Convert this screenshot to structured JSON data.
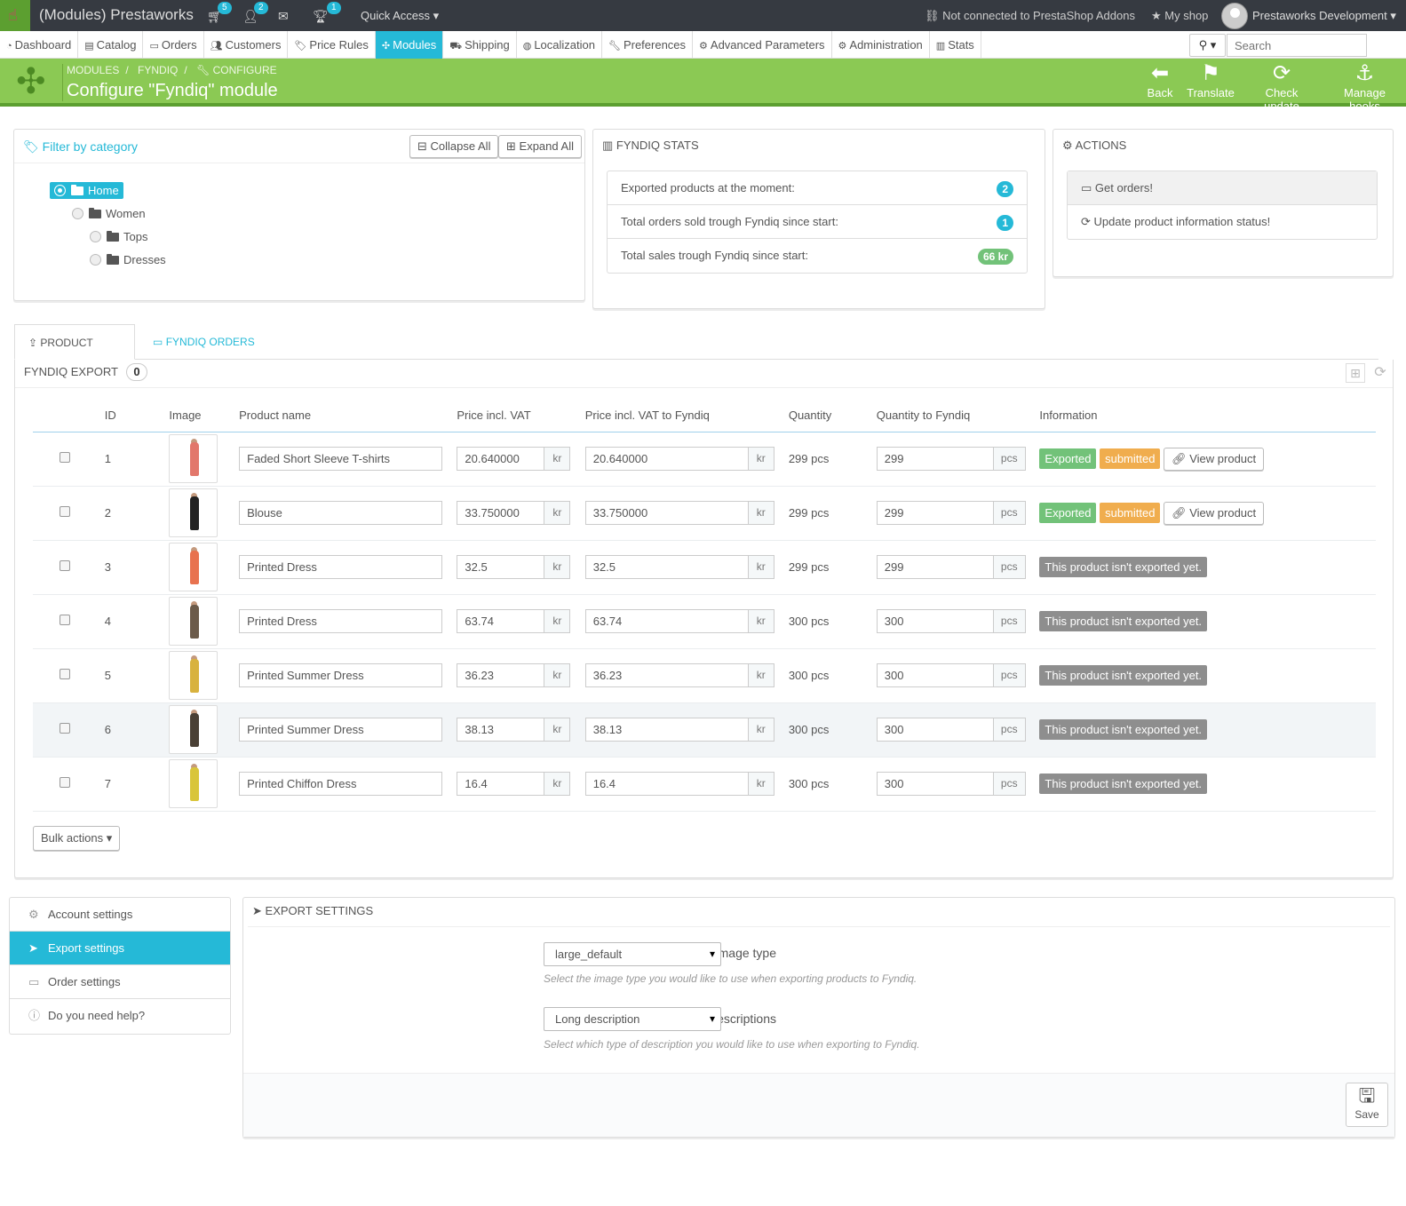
{
  "topbar": {
    "app_title": "(Modules) Prestaworks",
    "cart_count": "5",
    "customers_count": "2",
    "trophy_count": "1",
    "quick_access": "Quick Access",
    "addons_status": "Not connected to PrestaShop Addons",
    "my_shop": "My shop",
    "profile": "Prestaworks Development"
  },
  "nav": {
    "items": [
      {
        "label": "Dashboard",
        "icon": "dashboard-icon"
      },
      {
        "label": "Catalog",
        "icon": "book-icon"
      },
      {
        "label": "Orders",
        "icon": "credit-card-icon"
      },
      {
        "label": "Customers",
        "icon": "group-icon"
      },
      {
        "label": "Price Rules",
        "icon": "tags-icon"
      },
      {
        "label": "Modules",
        "icon": "puzzle-icon"
      },
      {
        "label": "Shipping",
        "icon": "truck-icon"
      },
      {
        "label": "Localization",
        "icon": "globe-icon"
      },
      {
        "label": "Preferences",
        "icon": "wrench-icon"
      },
      {
        "label": "Advanced Parameters",
        "icon": "cogs-icon"
      },
      {
        "label": "Administration",
        "icon": "cog-icon"
      },
      {
        "label": "Stats",
        "icon": "bar-chart-icon"
      }
    ],
    "active": "Modules",
    "search_placeholder": "Search"
  },
  "header": {
    "breadcrumb": [
      "Modules",
      "Fyndiq",
      "Configure"
    ],
    "title": "Configure \"Fyndiq\" module",
    "buttons": [
      "Back",
      "Translate",
      "Check update",
      "Manage hooks"
    ]
  },
  "category_panel": {
    "title": "Filter by category",
    "collapse_all": "Collapse All",
    "expand_all": "Expand All",
    "tree": [
      "Home",
      "Women",
      "Tops",
      "Dresses"
    ]
  },
  "stats_panel": {
    "title": "Fyndiq stats",
    "rows": [
      {
        "label": "Exported products at the moment:",
        "value": "2"
      },
      {
        "label": "Total orders sold trough Fyndiq since start:",
        "value": "1"
      },
      {
        "label": "Total sales trough Fyndiq since start:",
        "value": "66 kr"
      }
    ]
  },
  "actions_panel": {
    "title": "Actions",
    "items": [
      "Get orders!",
      "Update product information status!"
    ]
  },
  "tabs": {
    "product_export": "Product export",
    "fyndiq_orders": "Fyndiq orders"
  },
  "export_table": {
    "title": "Fyndiq export",
    "count": "0",
    "columns": [
      "ID",
      "Image",
      "Product name",
      "Price incl. VAT",
      "Price incl. VAT to Fyndiq",
      "Quantity",
      "Quantity to Fyndiq",
      "Information"
    ],
    "currency": "kr",
    "unit": "pcs",
    "rows": [
      {
        "id": "1",
        "name": "Faded Short Sleeve T-shirts",
        "price": "20.640000",
        "fyndiq_price": "20.640000",
        "quantity": "299 pcs",
        "fyndiq_qty": "299",
        "exported": true,
        "color": "#e2776b"
      },
      {
        "id": "2",
        "name": "Blouse",
        "price": "33.750000",
        "fyndiq_price": "33.750000",
        "quantity": "299 pcs",
        "fyndiq_qty": "299",
        "exported": true,
        "color": "#222222"
      },
      {
        "id": "3",
        "name": "Printed Dress",
        "price": "32.5",
        "fyndiq_price": "32.5",
        "quantity": "299 pcs",
        "fyndiq_qty": "299",
        "exported": false,
        "color": "#e8724f"
      },
      {
        "id": "4",
        "name": "Printed Dress",
        "price": "63.74",
        "fyndiq_price": "63.74",
        "quantity": "300 pcs",
        "fyndiq_qty": "300",
        "exported": false,
        "color": "#6b5b4a"
      },
      {
        "id": "5",
        "name": "Printed Summer Dress",
        "price": "36.23",
        "fyndiq_price": "36.23",
        "quantity": "300 pcs",
        "fyndiq_qty": "300",
        "exported": false,
        "color": "#d8b23e"
      },
      {
        "id": "6",
        "name": "Printed Summer Dress",
        "price": "38.13",
        "fyndiq_price": "38.13",
        "quantity": "300 pcs",
        "fyndiq_qty": "300",
        "exported": false,
        "color": "#4a4035"
      },
      {
        "id": "7",
        "name": "Printed Chiffon Dress",
        "price": "16.4",
        "fyndiq_price": "16.4",
        "quantity": "300 pcs",
        "fyndiq_qty": "300",
        "exported": false,
        "color": "#d9c53a"
      }
    ],
    "label_exported": "Exported",
    "label_submitted": "submitted",
    "view_product": "View product",
    "not_exported": "This product isn't exported yet.",
    "bulk_actions": "Bulk actions"
  },
  "settings_menu": {
    "items": [
      "Account settings",
      "Export settings",
      "Order settings",
      "Do you need help?"
    ],
    "active": "Export settings"
  },
  "export_settings": {
    "title": "Export settings",
    "image_type_label": "Image type",
    "image_type_value": "large_default",
    "image_type_help": "Select the image type you would like to use when exporting products to Fyndiq.",
    "desc_label": "Product descriptions",
    "desc_value": "Long description",
    "desc_help": "Select which type of description you would like to use when exporting to Fyndiq.",
    "save": "Save"
  },
  "colors": {
    "accent": "#25b9d7",
    "header_green": "#8bc954",
    "exported_green": "#72c279",
    "submitted_orange": "#f0ad4e",
    "not_exported_gray": "#8e8e8e",
    "topbar": "#363a41"
  }
}
